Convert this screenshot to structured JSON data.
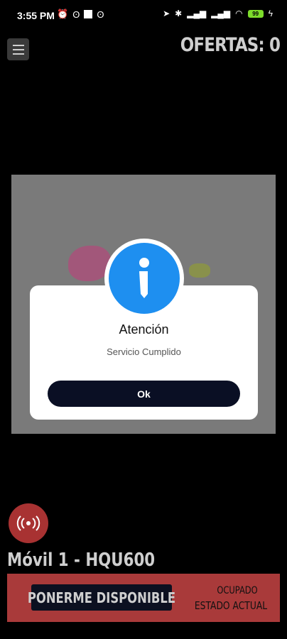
{
  "status_bar": {
    "time": "3:55 PM",
    "battery": "99"
  },
  "header": {
    "offers_label": "OFERTAS: 0"
  },
  "dialog": {
    "title": "Atención",
    "message": "Servicio Cumplido",
    "ok_label": "Ok",
    "accent_color": "#1e8ff0"
  },
  "footer": {
    "vehicle": "Móvil 1 - HQU600",
    "available_button": "PONERME DISPONIBLE",
    "state_value": "OCUPADO",
    "state_label": "ESTADO ACTUAL",
    "bar_color": "#a93a3a"
  }
}
